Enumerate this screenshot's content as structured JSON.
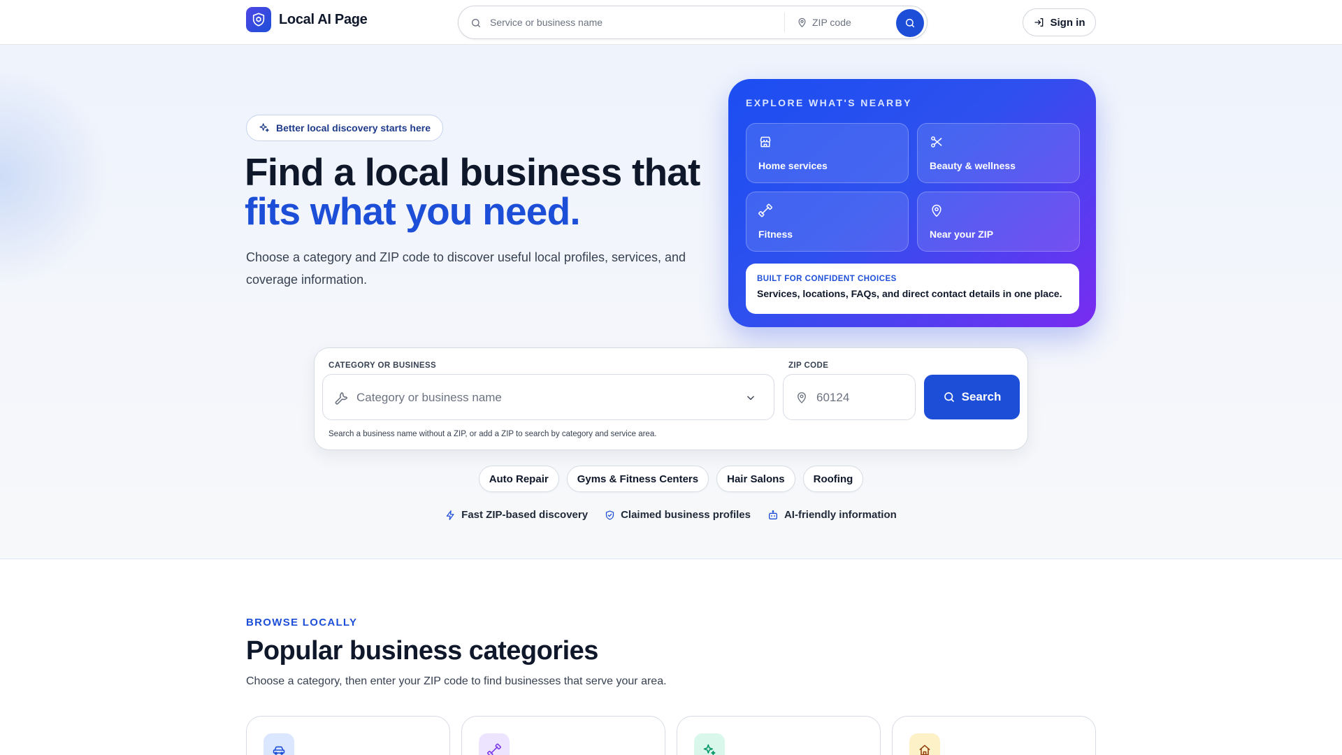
{
  "header": {
    "logo_text": "Local AI Page",
    "search_placeholder": "Service or business name",
    "zip_placeholder": "ZIP code",
    "search_button_icon": "search-icon",
    "signin_label": "Sign in",
    "signin_icon": "login-icon"
  },
  "hero": {
    "pill_label": "Better local discovery starts here",
    "pill_icon": "sparkles-icon",
    "title_line1": "Find a local business that",
    "title_line2": "fits what you need.",
    "subtitle": "Choose a category and ZIP code to discover useful local profiles, services, and coverage information."
  },
  "explore_card": {
    "eyebrow": "EXPLORE WHAT'S NEARBY",
    "tiles": [
      {
        "label": "Home services",
        "icon": "storefront-icon"
      },
      {
        "label": "Beauty & wellness",
        "icon": "scissors-icon"
      },
      {
        "label": "Fitness",
        "icon": "dumbbell-icon"
      },
      {
        "label": "Near your ZIP",
        "icon": "map-pin-icon"
      }
    ],
    "confidence_eyebrow": "BUILT FOR CONFIDENT CHOICES",
    "confidence_text": "Services, locations, FAQs, and direct contact details in one place."
  },
  "search": {
    "category_label": "CATEGORY OR BUSINESS",
    "category_placeholder": "Category or business name",
    "zip_label": "ZIP CODE",
    "zip_placeholder": "60124",
    "button_label": "Search",
    "help_text": "Search a business name without a ZIP, or add a ZIP to search by category and service area."
  },
  "quick_categories": [
    "Auto Repair",
    "Gyms & Fitness Centers",
    "Hair Salons",
    "Roofing"
  ],
  "features": [
    {
      "label": "Fast ZIP-based discovery",
      "icon": "lightning-icon"
    },
    {
      "label": "Claimed business profiles",
      "icon": "shield-check-icon"
    },
    {
      "label": "AI-friendly information",
      "icon": "robot-icon"
    }
  ],
  "browse": {
    "eyebrow": "BROWSE LOCALLY",
    "title": "Popular business categories",
    "subtitle": "Choose a category, then enter your ZIP code to find businesses that serve your area."
  },
  "category_cards": [
    {
      "icon": "car-icon",
      "bg": "#dbe7ff",
      "color": "#1d4ed8"
    },
    {
      "icon": "dumbbell-icon",
      "bg": "#ede4ff",
      "color": "#7c3aed"
    },
    {
      "icon": "sparkles-icon",
      "bg": "#d9f7ea",
      "color": "#059669"
    },
    {
      "icon": "home-icon",
      "bg": "#fdf1c7",
      "color": "#92400e"
    }
  ],
  "colors": {
    "accent": "#1d4ed8",
    "card_gradient_start": "#1c4ef2",
    "card_gradient_end": "#7a2bf0",
    "text": "#0f172a",
    "muted": "#374151"
  }
}
